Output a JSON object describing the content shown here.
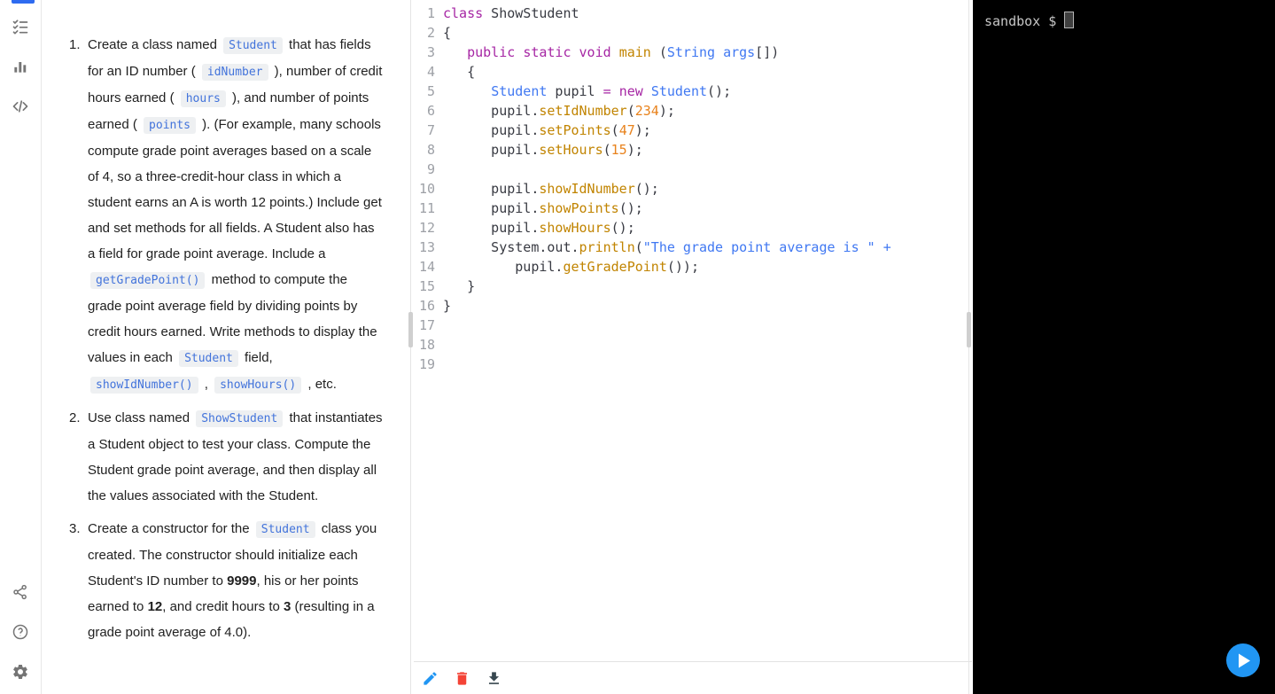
{
  "colors": {
    "accent_blue": "#2196F3",
    "icon_gray": "#757575",
    "kw": "#A626A4",
    "ty": "#4078F2",
    "fn": "#C18401",
    "nu": "#E8821C",
    "st": "#4078F2",
    "op": "#4078F2",
    "plain": "#383A42",
    "line_number": "#9DA0A6",
    "chip_bg": "#EEF0F2",
    "chip_fg": "#4273DB",
    "divider": "#E4E4E4",
    "terminal_bg": "#000000",
    "terminal_fg": "#C7C7C7",
    "trash_red": "#F44336",
    "download_dark": "#37474F"
  },
  "rail": {
    "top_icons": [
      {
        "name": "guide-checklist-icon"
      },
      {
        "name": "bar-chart-icon"
      },
      {
        "name": "code-icon"
      }
    ],
    "bottom_icons": [
      {
        "name": "share-icon"
      },
      {
        "name": "help-icon"
      },
      {
        "name": "settings-gear-icon"
      }
    ]
  },
  "instructions": {
    "items": [
      {
        "num": "1.",
        "segments": [
          {
            "t": "Create a class named "
          },
          {
            "t": "Student",
            "s": "code"
          },
          {
            "t": " that has fields for an ID number ( "
          },
          {
            "t": "idNumber",
            "s": "code"
          },
          {
            "t": " ), number of credit hours earned ( "
          },
          {
            "t": "hours",
            "s": "code"
          },
          {
            "t": " ), and number of points earned ( "
          },
          {
            "t": "points",
            "s": "code"
          },
          {
            "t": " ). (For example, many schools compute grade point averages based on a scale of 4, so a three-credit-hour class in which a student earns an A is worth 12 points.) Include get and set methods for all fields. A Student also has a field for grade point average. Include a "
          },
          {
            "t": "getGradePoint()",
            "s": "code"
          },
          {
            "t": " method to compute the grade point average field by dividing points by credit hours earned. Write methods to display the values in each "
          },
          {
            "t": "Student",
            "s": "code"
          },
          {
            "t": " field, "
          },
          {
            "t": "showIdNumber()",
            "s": "code"
          },
          {
            "t": " , "
          },
          {
            "t": "showHours()",
            "s": "code"
          },
          {
            "t": " , etc."
          }
        ]
      },
      {
        "num": "2.",
        "segments": [
          {
            "t": "Use class named "
          },
          {
            "t": "ShowStudent",
            "s": "code"
          },
          {
            "t": " that instantiates a Student object to test your class. Compute the Student grade point average, and then display all the values associated with the Student."
          }
        ]
      },
      {
        "num": "3.",
        "segments": [
          {
            "t": "Create a constructor for the "
          },
          {
            "t": "Student",
            "s": "code"
          },
          {
            "t": " class you created. The constructor should initialize each Student's ID number to "
          },
          {
            "t": "9999",
            "s": "bold"
          },
          {
            "t": ", his or her points earned to "
          },
          {
            "t": "12",
            "s": "bold"
          },
          {
            "t": ", and credit hours to "
          },
          {
            "t": "3",
            "s": "bold"
          },
          {
            "t": " (resulting in a grade point average of 4.0)."
          }
        ]
      }
    ]
  },
  "editor": {
    "lines": [
      {
        "n": "1",
        "t": [
          [
            "kw",
            "class"
          ],
          [
            "pl",
            " ShowStudent"
          ]
        ]
      },
      {
        "n": "2",
        "t": [
          [
            "pl",
            "{"
          ]
        ]
      },
      {
        "n": "3",
        "t": [
          [
            "pl",
            "   "
          ],
          [
            "kw",
            "public"
          ],
          [
            "pl",
            " "
          ],
          [
            "kw",
            "static"
          ],
          [
            "pl",
            " "
          ],
          [
            "kw",
            "void"
          ],
          [
            "pl",
            " "
          ],
          [
            "fn",
            "main"
          ],
          [
            "pl",
            " ("
          ],
          [
            "ty",
            "String"
          ],
          [
            "pl",
            " "
          ],
          [
            "ty",
            "args"
          ],
          [
            "pl",
            "[])"
          ]
        ]
      },
      {
        "n": "4",
        "t": [
          [
            "pl",
            "   {"
          ]
        ]
      },
      {
        "n": "5",
        "t": [
          [
            "pl",
            "      "
          ],
          [
            "ty",
            "Student"
          ],
          [
            "pl",
            " pupil "
          ],
          [
            "kw",
            "="
          ],
          [
            "pl",
            " "
          ],
          [
            "kw",
            "new"
          ],
          [
            "pl",
            " "
          ],
          [
            "ty",
            "Student"
          ],
          [
            "pl",
            "();"
          ]
        ]
      },
      {
        "n": "6",
        "t": [
          [
            "pl",
            "      pupil."
          ],
          [
            "fn",
            "setIdNumber"
          ],
          [
            "pl",
            "("
          ],
          [
            "nu",
            "234"
          ],
          [
            "pl",
            ");"
          ]
        ]
      },
      {
        "n": "7",
        "t": [
          [
            "pl",
            "      pupil."
          ],
          [
            "fn",
            "setPoints"
          ],
          [
            "pl",
            "("
          ],
          [
            "nu",
            "47"
          ],
          [
            "pl",
            ");"
          ]
        ]
      },
      {
        "n": "8",
        "t": [
          [
            "pl",
            "      pupil."
          ],
          [
            "fn",
            "setHours"
          ],
          [
            "pl",
            "("
          ],
          [
            "nu",
            "15"
          ],
          [
            "pl",
            ");"
          ]
        ]
      },
      {
        "n": "9",
        "t": []
      },
      {
        "n": "10",
        "t": [
          [
            "pl",
            "      pupil."
          ],
          [
            "fn",
            "showIdNumber"
          ],
          [
            "pl",
            "();"
          ]
        ]
      },
      {
        "n": "11",
        "t": [
          [
            "pl",
            "      pupil."
          ],
          [
            "fn",
            "showPoints"
          ],
          [
            "pl",
            "();"
          ]
        ]
      },
      {
        "n": "12",
        "t": [
          [
            "pl",
            "      pupil."
          ],
          [
            "fn",
            "showHours"
          ],
          [
            "pl",
            "();"
          ]
        ]
      },
      {
        "n": "13",
        "t": [
          [
            "pl",
            "      System.out."
          ],
          [
            "fn",
            "println"
          ],
          [
            "pl",
            "("
          ],
          [
            "st",
            "\"The grade point average is \""
          ],
          [
            "pl",
            " "
          ],
          [
            "op",
            "+"
          ]
        ]
      },
      {
        "n": "14",
        "t": [
          [
            "pl",
            "         pupil."
          ],
          [
            "fn",
            "getGradePoint"
          ],
          [
            "pl",
            "());"
          ]
        ]
      },
      {
        "n": "15",
        "t": [
          [
            "pl",
            "   }"
          ]
        ]
      },
      {
        "n": "16",
        "t": [
          [
            "pl",
            "}"
          ]
        ]
      },
      {
        "n": "17",
        "t": []
      },
      {
        "n": "18",
        "t": []
      },
      {
        "n": "19",
        "t": []
      }
    ],
    "toolbar": [
      {
        "name": "edit-pencil-icon"
      },
      {
        "name": "delete-trash-icon"
      },
      {
        "name": "download-icon"
      }
    ]
  },
  "terminal": {
    "prompt": "sandbox",
    "symbol": "$"
  },
  "run_button": {
    "name": "run-play-button"
  }
}
